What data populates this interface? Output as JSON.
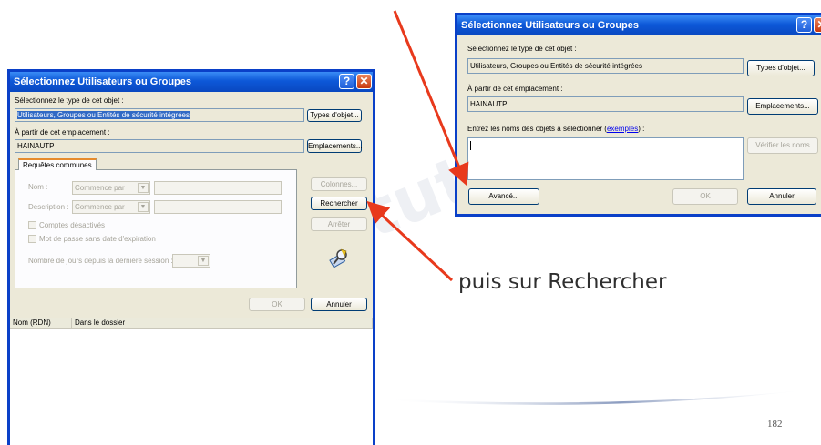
{
  "left_dialog": {
    "title": "Sélectionnez Utilisateurs ou Groupes",
    "object_type_label": "Sélectionnez le type de cet objet :",
    "object_type_value": "Utilisateurs, Groupes ou Entités de sécurité intégrées",
    "object_types_button": "Types d'objet...",
    "location_label": "À partir de cet emplacement :",
    "location_value": "HAINAUTP",
    "locations_button": "Emplacements...",
    "tab_label": "Requêtes communes",
    "name_label": "Nom :",
    "name_mode": "Commence par",
    "description_label": "Description :",
    "description_mode": "Commence par",
    "disabled_accounts_label": "Comptes désactivés",
    "no_expiry_label": "Mot de passe sans date d'expiration",
    "days_label": "Nombre de jours depuis la dernière session :",
    "columns_button": "Colonnes...",
    "search_button": "Rechercher",
    "stop_button": "Arrêter",
    "ok_button": "OK",
    "cancel_button": "Annuler",
    "results_columns": [
      "Nom (RDN)",
      "Dans le dossier"
    ]
  },
  "right_dialog": {
    "title": "Sélectionnez Utilisateurs ou Groupes",
    "object_type_label": "Sélectionnez le type de cet objet :",
    "object_type_value": "Utilisateurs, Groupes ou Entités de sécurité intégrées",
    "object_types_button": "Types d'objet...",
    "location_label": "À partir de cet emplacement :",
    "location_value": "HAINAUTP",
    "locations_button": "Emplacements...",
    "names_label_prefix": "Entrez les noms des objets à sélectionner (",
    "names_label_link": "exemples",
    "names_label_suffix": ") :",
    "check_names_button": "Vérifier les noms",
    "advanced_button": "Avancé...",
    "ok_button": "OK",
    "cancel_button": "Annuler"
  },
  "caption": "puis sur Rechercher",
  "page_number": "182",
  "watermark_text": "tutoriel",
  "colors": {
    "title_bar": "#0d58d8",
    "dialog_bg": "#ece9d8",
    "arrow": "#e8391c"
  },
  "icons": {
    "help": "question-icon",
    "close": "close-icon",
    "search_tool": "search-tool-icon"
  }
}
